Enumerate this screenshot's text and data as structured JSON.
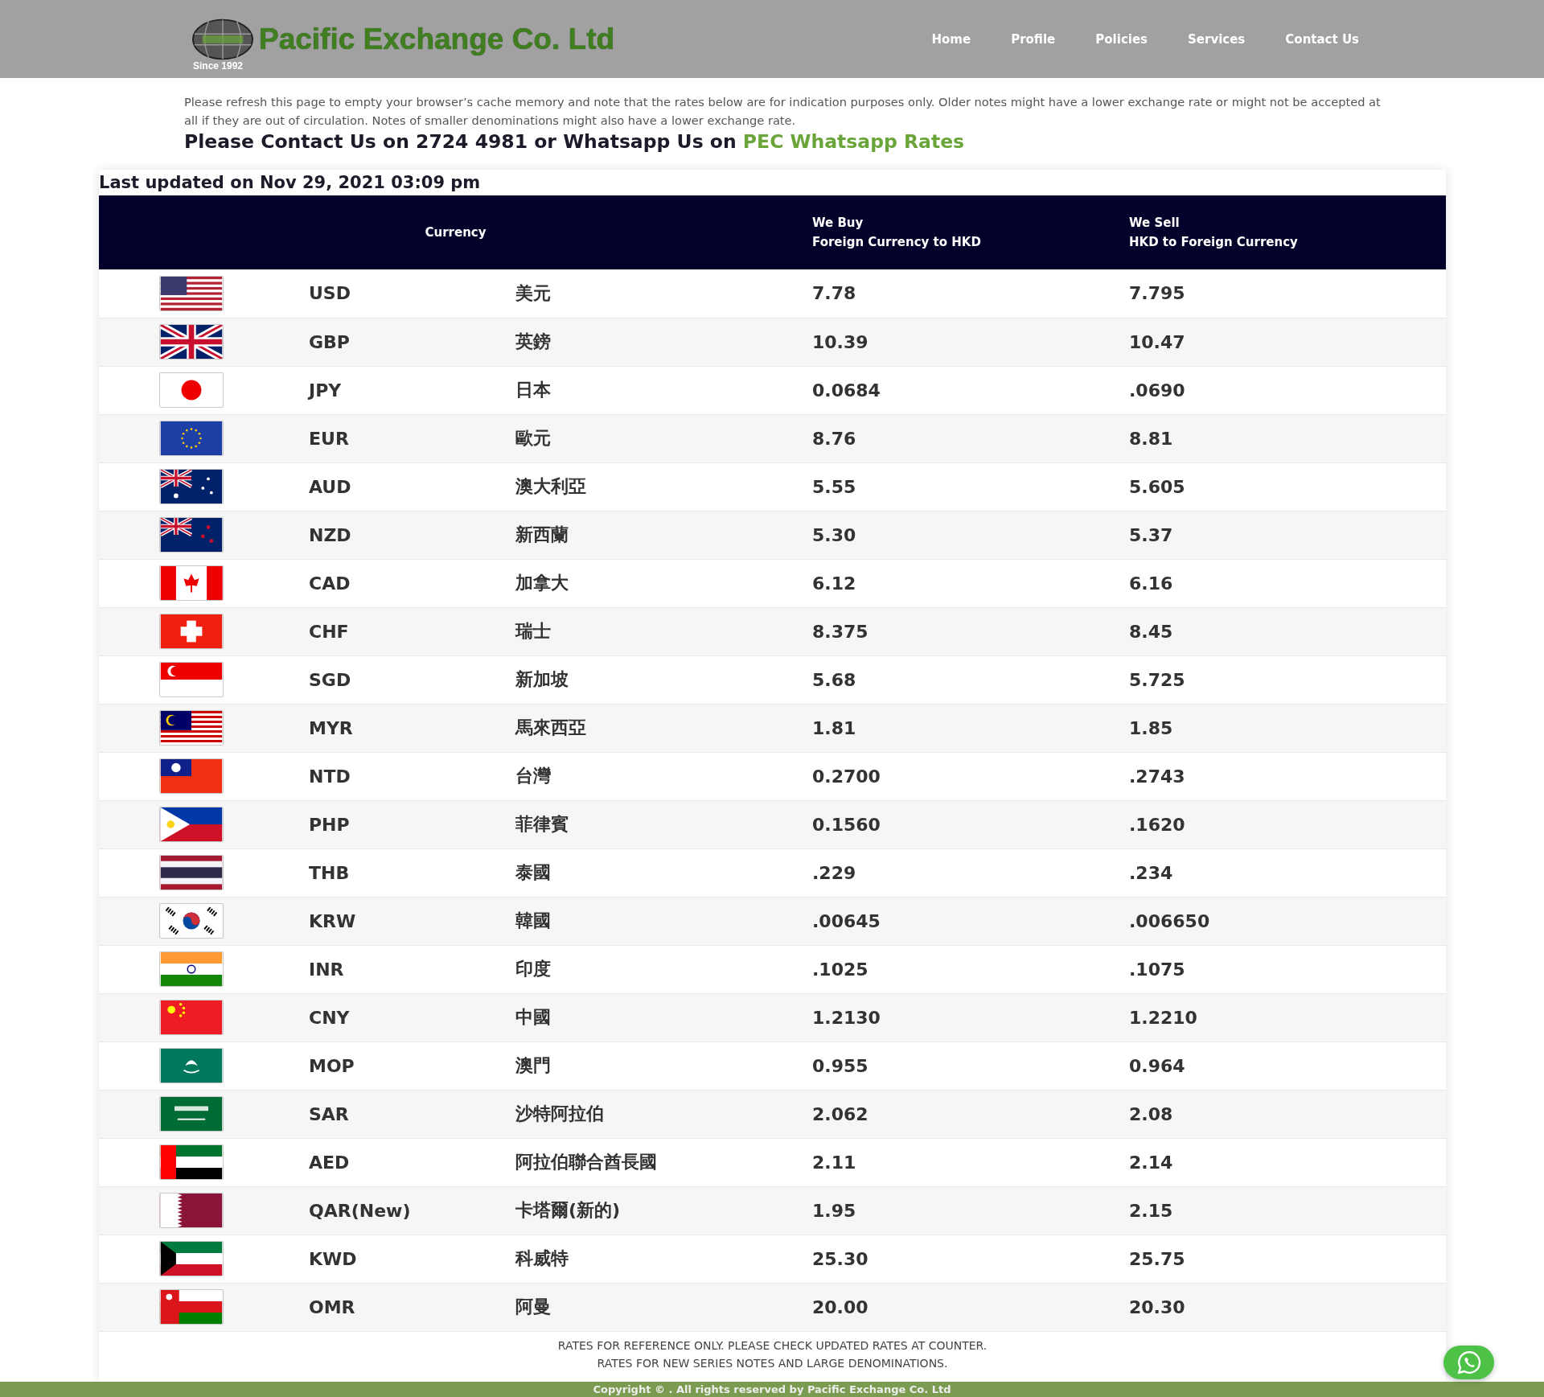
{
  "header": {
    "logo_title": "Pacific Exchange Co. Ltd",
    "logo_since": "Since 1992",
    "nav": [
      {
        "label": "Home"
      },
      {
        "label": "Profile"
      },
      {
        "label": "Policies"
      },
      {
        "label": "Services"
      },
      {
        "label": "Contact Us"
      }
    ]
  },
  "notice": "Please refresh this page to empty your browser’s cache memory and note that the rates below are for indication purposes only. Older notes might have a lower exchange rate or might not be accepted at all if they are out of circulation. Notes of smaller denominations might also have a lower exchange rate.",
  "contact": {
    "text": "Please Contact Us on 2724 4981 or Whatsapp Us on",
    "link": "PEC Whatsapp Rates"
  },
  "last_updated": "Last updated on Nov 29, 2021 03:09 pm",
  "table": {
    "columns": [
      {
        "line1": "Currency"
      },
      {
        "line1": "We Buy",
        "line2": "Foreign Currency to HKD"
      },
      {
        "line1": "We Sell",
        "line2": "HKD to Foreign Currency"
      }
    ],
    "rows": [
      {
        "code": "USD",
        "name": "美元",
        "buy": "7.78",
        "sell": "7.795"
      },
      {
        "code": "GBP",
        "name": "英鎊",
        "buy": "10.39",
        "sell": "10.47"
      },
      {
        "code": "JPY",
        "name": "日本",
        "buy": "0.0684",
        "sell": ".0690"
      },
      {
        "code": "EUR",
        "name": "歐元",
        "buy": "8.76",
        "sell": "8.81"
      },
      {
        "code": "AUD",
        "name": "澳大利亞",
        "buy": "5.55",
        "sell": "5.605"
      },
      {
        "code": "NZD",
        "name": "新西蘭",
        "buy": "5.30",
        "sell": "5.37"
      },
      {
        "code": "CAD",
        "name": "加拿大",
        "buy": "6.12",
        "sell": "6.16"
      },
      {
        "code": "CHF",
        "name": "瑞士",
        "buy": "8.375",
        "sell": "8.45"
      },
      {
        "code": "SGD",
        "name": "新加坡",
        "buy": "5.68",
        "sell": "5.725"
      },
      {
        "code": "MYR",
        "name": "馬來西亞",
        "buy": "1.81",
        "sell": "1.85"
      },
      {
        "code": "NTD",
        "name": "台灣",
        "buy": "0.2700",
        "sell": ".2743"
      },
      {
        "code": "PHP",
        "name": "菲律賓",
        "buy": "0.1560",
        "sell": ".1620"
      },
      {
        "code": "THB",
        "name": "泰國",
        "buy": ".229",
        "sell": ".234"
      },
      {
        "code": "KRW",
        "name": "韓國",
        "buy": ".00645",
        "sell": ".006650"
      },
      {
        "code": "INR",
        "name": "印度",
        "buy": ".1025",
        "sell": ".1075"
      },
      {
        "code": "CNY",
        "name": "中國",
        "buy": "1.2130",
        "sell": "1.2210"
      },
      {
        "code": "MOP",
        "name": "澳門",
        "buy": "0.955",
        "sell": "0.964"
      },
      {
        "code": "SAR",
        "name": "沙特阿拉伯",
        "buy": "2.062",
        "sell": "2.08"
      },
      {
        "code": "AED",
        "name": "阿拉伯聯合酋長國",
        "buy": "2.11",
        "sell": "2.14"
      },
      {
        "code": "QAR(New)",
        "name": "卡塔爾(新的)",
        "buy": "1.95",
        "sell": "2.15"
      },
      {
        "code": "KWD",
        "name": "科威特",
        "buy": "25.30",
        "sell": "25.75"
      },
      {
        "code": "OMR",
        "name": "阿曼",
        "buy": "20.00",
        "sell": "20.30"
      }
    ]
  },
  "disclaimer": [
    "RATES FOR REFERENCE ONLY. PLEASE CHECK UPDATED RATES AT COUNTER.",
    "RATES FOR NEW SERIES NOTES AND LARGE DENOMINATIONS."
  ],
  "footer": "Copyright © . All rights reserved by Pacific Exchange Co. Ltd"
}
